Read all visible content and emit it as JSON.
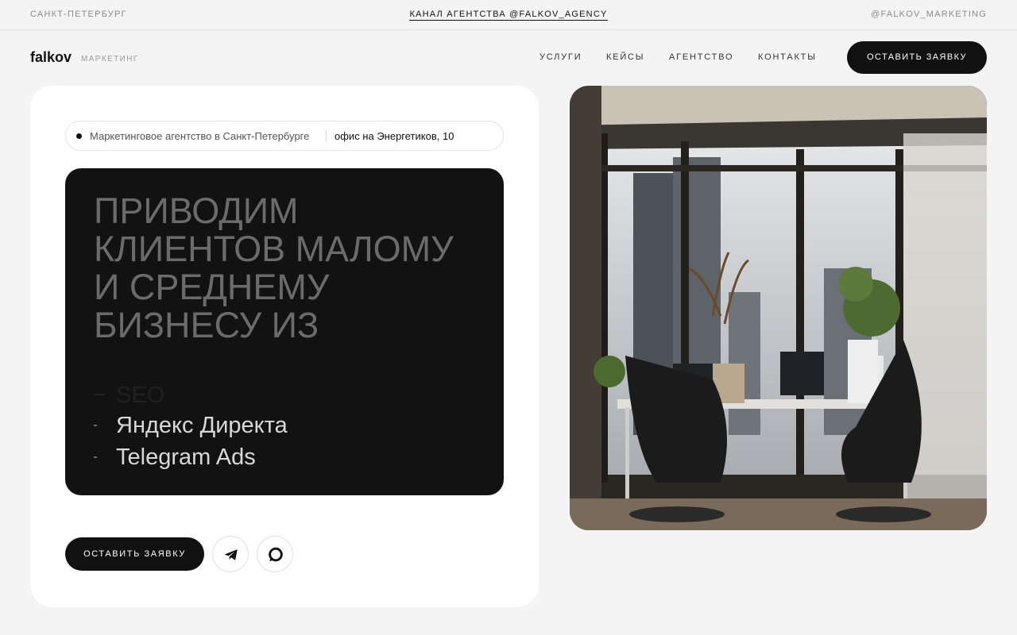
{
  "topbar": {
    "city": "САНКТ-ПЕТЕРБУРГ",
    "channel": "КАНАЛ АГЕНТСТВА @FALKOV_AGENCY",
    "handle": "@FALKOV_MARKETING"
  },
  "nav": {
    "logo": "falkov",
    "logo_sub": "МАРКЕТИНГ",
    "items": [
      "УСЛУГИ",
      "КЕЙСЫ",
      "АГЕНТСТВО",
      "КОНТАКТЫ"
    ],
    "cta": "ОСТАВИТЬ ЗАЯВКУ"
  },
  "hero": {
    "badge_text": "Маркетинговое агентство в Санкт-Петербурге",
    "badge_address": "офис на Энергетиков, 10",
    "headline": "ПРИВОДИМ КЛИЕНТОВ МАЛОМУ И СРЕДНЕМУ БИЗНЕСУ ИЗ",
    "services": [
      "SEO",
      "Яндекс Директа",
      "Telegram Ads"
    ],
    "cta": "ОСТАВИТЬ ЗАЯВКУ",
    "social_icons": [
      "telegram-icon",
      "chat-icon"
    ]
  },
  "colors": {
    "background": "#f4f4f4",
    "accent": "#111111",
    "card": "#ffffff",
    "dark_panel": "#121212"
  }
}
